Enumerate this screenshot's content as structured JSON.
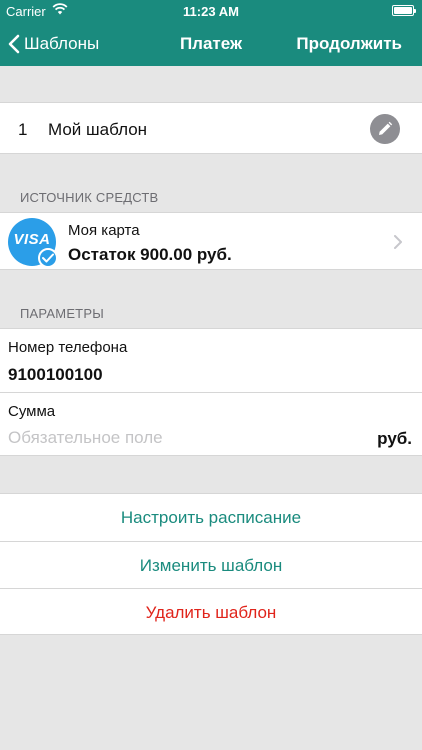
{
  "status_bar": {
    "carrier": "Carrier",
    "time": "11:23 AM"
  },
  "nav": {
    "back_label": "Шаблоны",
    "title": "Платеж",
    "next_label": "Продолжить"
  },
  "template": {
    "number": "1",
    "name": "Мой шаблон"
  },
  "source": {
    "header": "ИСТОЧНИК СРЕДСТВ",
    "card_brand": "VISA",
    "card_name": "Моя карта",
    "balance": "Остаток 900.00 руб."
  },
  "params": {
    "header": "ПАРАМЕТРЫ",
    "phone_label": "Номер телефона",
    "phone_value": "9100100100",
    "sum_label": "Сумма",
    "sum_placeholder": "Обязательное поле",
    "sum_value": "",
    "currency": "руб."
  },
  "actions": {
    "schedule": "Настроить расписание",
    "edit": "Изменить шаблон",
    "delete": "Удалить шаблон"
  },
  "colors": {
    "accent": "#1a8b7e",
    "danger": "#e0241b",
    "visa": "#2b9ee8"
  }
}
